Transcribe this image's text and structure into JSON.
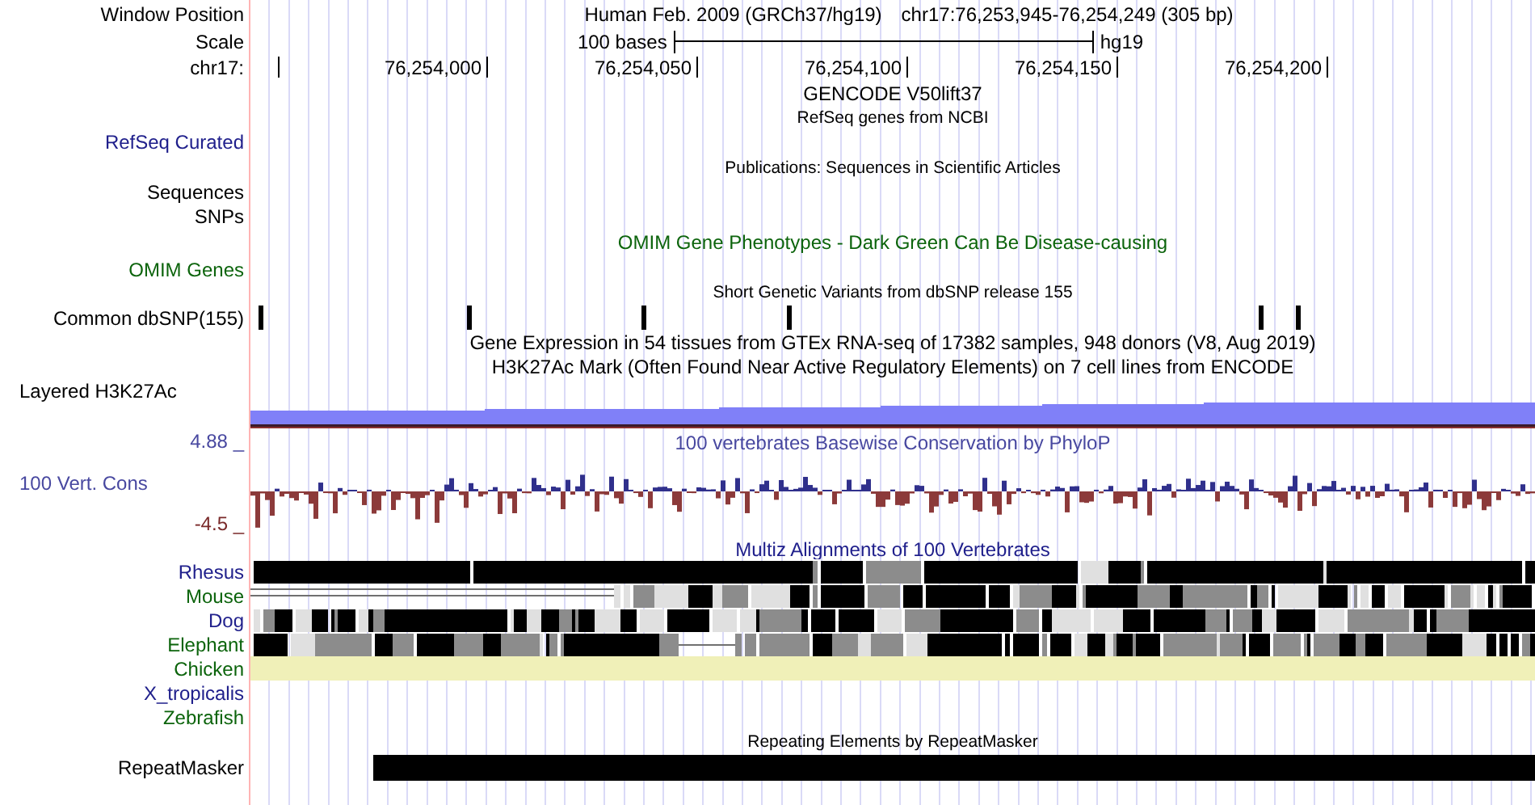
{
  "header": {
    "position_label": "Window Position",
    "scale_label": "Scale",
    "chrom_label": "chr17:",
    "assembly": "Human Feb. 2009 (GRCh37/hg19)",
    "position": "chr17:76,253,945-76,254,249 (305 bp)",
    "scale_text": "100 bases",
    "scale_db": "hg19",
    "ticks": [
      "76,254,000",
      "76,254,050",
      "76,254,100",
      "76,254,150",
      "76,254,200"
    ]
  },
  "rows": [
    {
      "kind": "title",
      "text": "GENCODE V50lift37",
      "color": "#000000"
    },
    {
      "kind": "note",
      "text": "RefSeq genes from NCBI",
      "color": "#000000"
    },
    {
      "kind": "label",
      "label": "RefSeq Curated",
      "color": "#20208c"
    },
    {
      "kind": "note",
      "text": "Publications: Sequences in Scientific Articles",
      "color": "#000000"
    },
    {
      "kind": "label",
      "label": "Sequences",
      "color": "#000000"
    },
    {
      "kind": "label",
      "label": "SNPs",
      "color": "#000000"
    },
    {
      "kind": "title",
      "text": "OMIM Gene Phenotypes - Dark Green Can Be Disease-causing",
      "color": "#0c640c"
    },
    {
      "kind": "label",
      "label": "OMIM Genes",
      "color": "#0c640c"
    },
    {
      "kind": "note",
      "text": "Short Genetic Variants from dbSNP release 155",
      "color": "#000000"
    },
    {
      "kind": "snps",
      "label": "Common dbSNP(155)",
      "color": "#000000"
    },
    {
      "kind": "title",
      "text": "Gene Expression in 54 tissues from GTEx RNA-seq of 17382 samples, 948 donors (V8, Aug 2019)",
      "color": "#000000"
    },
    {
      "kind": "title",
      "text": "H3K27Ac Mark (Often Found Near Active Regulatory Elements) on 7 cell lines from ENCODE",
      "color": "#000000"
    },
    {
      "kind": "signal",
      "label": "Layered H3K27Ac",
      "color": "#000000"
    },
    {
      "kind": "conservation",
      "title": "100 vertebrates Basewise Conservation by PhyloP",
      "label": "100 Vert. Cons",
      "max": "4.88 _",
      "min": "-4.5 _",
      "color": "#4848a0"
    },
    {
      "kind": "alignment",
      "title": "Multiz Alignments of 100 Vertebrates",
      "color": "#20208c",
      "species": [
        {
          "name": "Rhesus",
          "color": "#20208c",
          "kind": "blocks"
        },
        {
          "name": "Mouse",
          "color": "#0c640c",
          "kind": "blocks"
        },
        {
          "name": "Dog",
          "color": "#20208c",
          "kind": "blocks"
        },
        {
          "name": "Elephant",
          "color": "#0c640c",
          "kind": "blocks"
        },
        {
          "name": "Chicken",
          "color": "#0c640c",
          "kind": "band"
        },
        {
          "name": "X_tropicalis",
          "color": "#20208c",
          "kind": "empty"
        },
        {
          "name": "Zebrafish",
          "color": "#0c640c",
          "kind": "empty"
        }
      ]
    },
    {
      "kind": "note",
      "text": "Repeating Elements by RepeatMasker",
      "color": "#000000"
    },
    {
      "kind": "repeats",
      "label": "RepeatMasker",
      "color": "#000000"
    }
  ]
}
